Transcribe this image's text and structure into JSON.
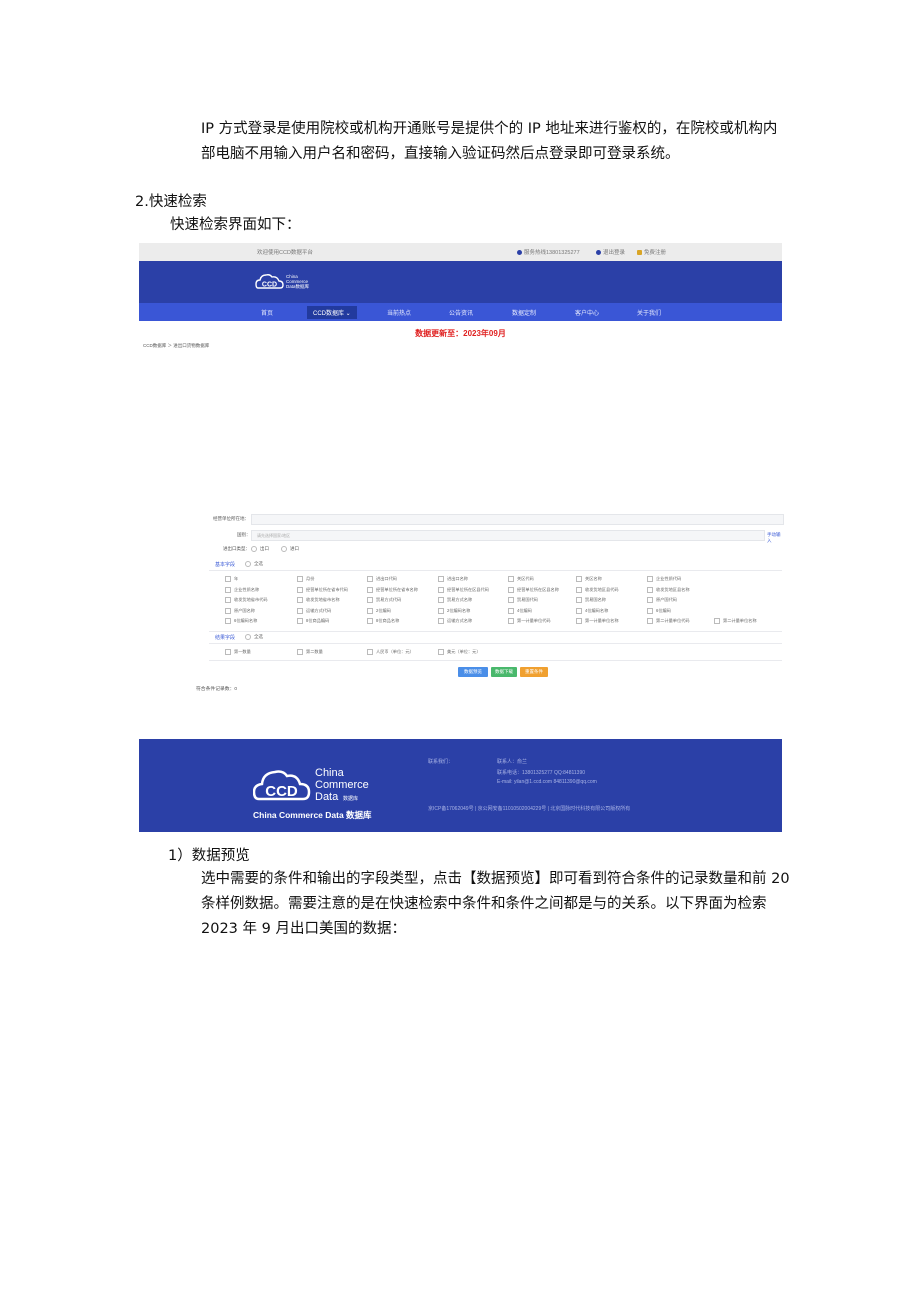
{
  "doc": {
    "para_ip_login": "IP 方式登录是使用院校或机构开通账号是提供个的 IP 地址来进行鉴权的，在院校或机构内部电脑不用输入用户名和密码，直接输入验证码然后点登录即可登录系统。",
    "heading_quick_search": "2.快速检索",
    "quick_search_intro": "快速检索界面如下：",
    "heading_preview": "1）数据预览",
    "para_preview": "选中需要的条件和输出的字段类型，点击【数据预览】即可看到符合条件的记录数量和前 20 条样例数据。需要注意的是在快速检索中条件和条件之间都是与的关系。以下界面为检索 2023 年 9 月出口美国的数据："
  },
  "screenshot": {
    "topbar": {
      "welcome": "欢迎使用CCD数据平台",
      "hotline": "服务热线13801325277",
      "logout": "退出登录",
      "register": "免费注册"
    },
    "logo": {
      "line1": "China",
      "line2": "Commerce",
      "line3": "Data数据库",
      "mark": "CCD"
    },
    "nav": [
      "首页",
      "CCD数据库",
      "当前热点",
      "公告资讯",
      "数据定制",
      "客户中心",
      "关于我们"
    ],
    "nav_active_index": 1,
    "update_notice": "数据更新至：2023年09月",
    "breadcrumb": "CCD数据库 ＞ 进出口货物数据库",
    "form": {
      "unit_label": "经营单位所在地：",
      "country_label": "国别：",
      "country_placeholder": "请先选择国家/地区",
      "manual_input": "手动输入",
      "direction_label": "进出口类型：",
      "direction_options": [
        "出口",
        "进口"
      ],
      "basic_fields_title": "基本字段",
      "select_all": "全选",
      "basic_fields": [
        [
          "年",
          "月份",
          "进出口代码",
          "进出口名称",
          "关区代码",
          "关区名称",
          "企业性质代码"
        ],
        [
          "企业性质名称",
          "经营单位所在省市代码",
          "经营单位所在省市名称",
          "经营单位所在区县代码",
          "经营单位所在区县名称",
          "收发货地区县代码",
          "收发货地区县名称"
        ],
        [
          "收发货地省市代码",
          "收发货地省市名称",
          "贸易方式代码",
          "贸易方式名称",
          "贸易国代码",
          "贸易国名称",
          "原产国代码"
        ],
        [
          "原产国名称",
          "运输方式代码",
          "2位编码",
          "2位编码名称",
          "4位编码",
          "4位编码名称",
          "6位编码"
        ],
        [
          "6位编码名称",
          "8位商品编码",
          "8位商品名称",
          "运输方式名称",
          "第一计量单位代码",
          "第一计量单位名称",
          "第二计量单位代码",
          "第二计量单位名称"
        ]
      ],
      "result_fields_title": "结果字段",
      "result_fields": [
        "第一数量",
        "第二数量",
        "人民币（单位：元）",
        "美元（单位：元）"
      ],
      "buttons": [
        {
          "label": "数据预览",
          "color": "#4a8ee8"
        },
        {
          "label": "数据下载",
          "color": "#49b86c"
        },
        {
          "label": "重置条件",
          "color": "#f0a030"
        }
      ],
      "record_count_label": "符合条件记录数：",
      "record_count": "0"
    },
    "footer": {
      "contact_label": "联系我们：",
      "contact_person": "联系人：俞兰",
      "phone": "联系电话：13801325277 QQ:84811390",
      "email": "E-mail: yilan@1.ccd.com 84811390@qq.com",
      "icp": "京ICP备17062049号 | 京公网安备11010502004229号 | 北京国脉时代科技有限公司版权所有",
      "logo_line1": "China",
      "logo_line2": "Commerce",
      "logo_line3": "Data",
      "logo_small": "数据库",
      "logo_mark": "CCD",
      "subtitle": "China Commerce Data 数据库"
    },
    "colors": {
      "banner": "#2b40a7",
      "nav": "#3a56d6",
      "update": "#e02020"
    }
  }
}
